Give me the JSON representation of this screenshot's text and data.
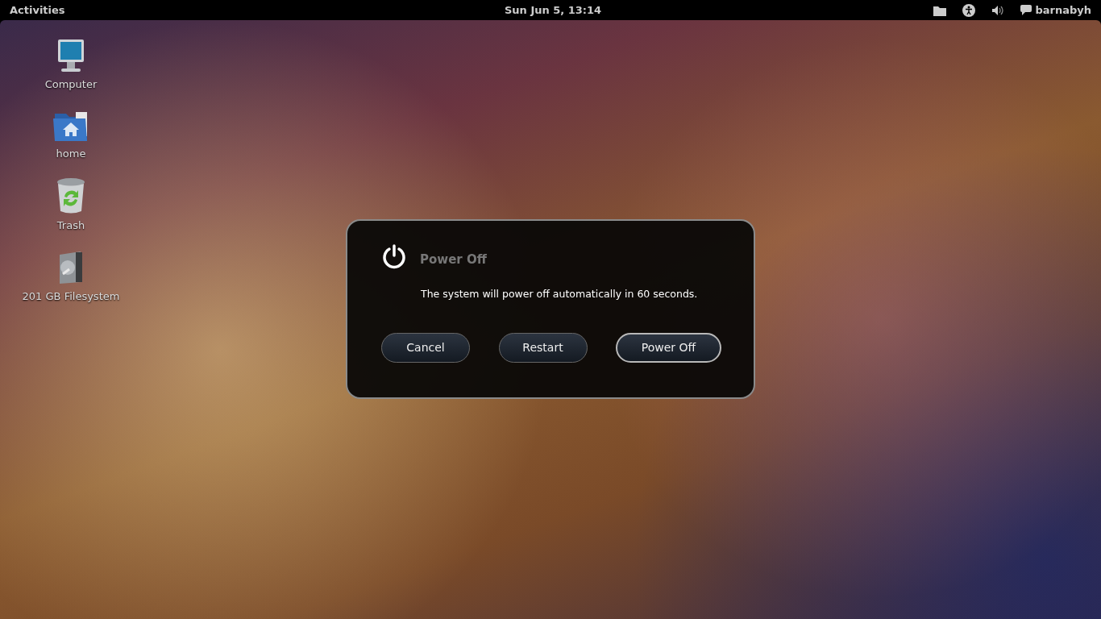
{
  "top_bar": {
    "activities": "Activities",
    "clock": "Sun Jun  5, 13:14",
    "user": "barnabyh"
  },
  "desktop_icons": [
    {
      "kind": "computer",
      "label": "Computer"
    },
    {
      "kind": "home",
      "label": "home"
    },
    {
      "kind": "trash",
      "label": "Trash"
    },
    {
      "kind": "drive",
      "label": "201 GB Filesystem"
    }
  ],
  "dialog": {
    "title": "Power Off",
    "message": "The system will power off automatically in 60 seconds.",
    "buttons": [
      {
        "label": "Cancel",
        "default": false
      },
      {
        "label": "Restart",
        "default": false
      },
      {
        "label": "Power Off",
        "default": true
      }
    ]
  }
}
